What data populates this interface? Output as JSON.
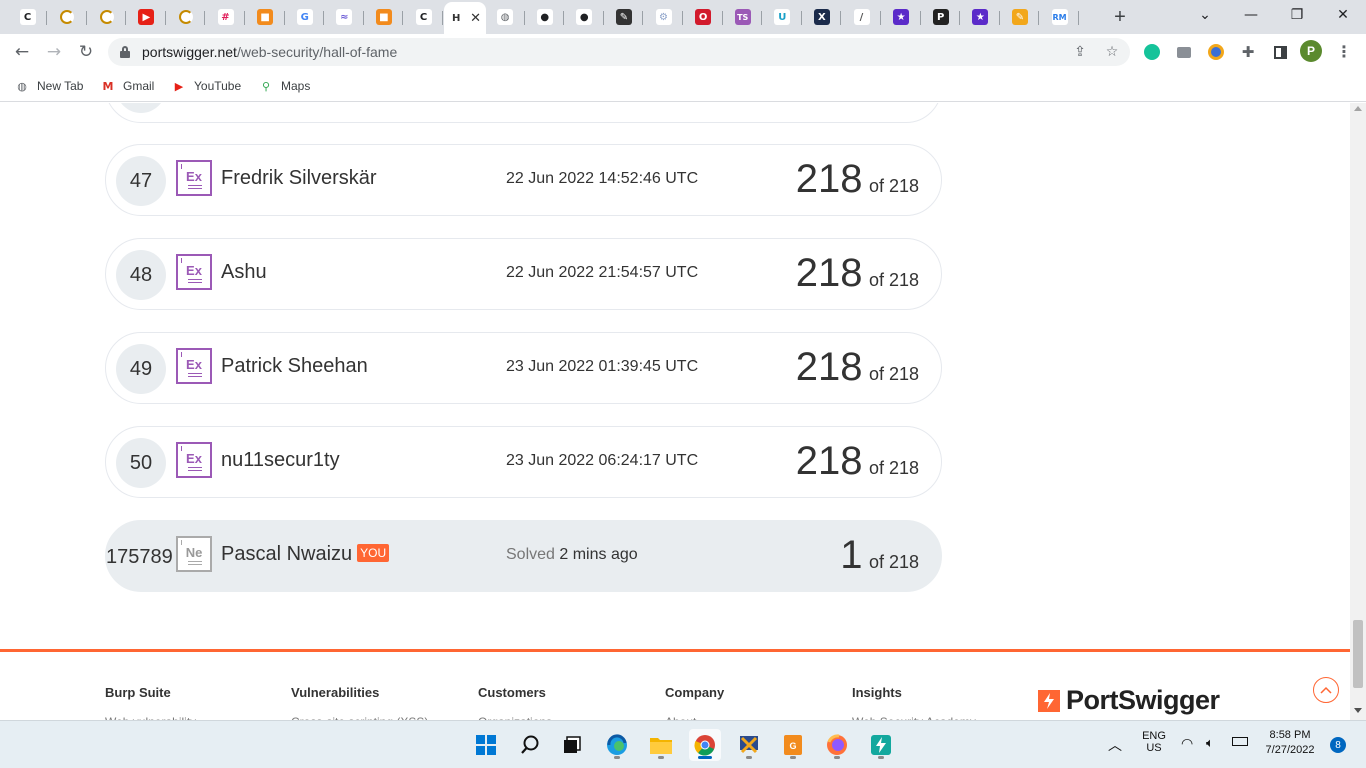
{
  "browser": {
    "tabs": [
      {
        "icon": "chatgpt-icon",
        "glyph": "C",
        "color": "#202124",
        "bg": "#ffffff"
      },
      {
        "icon": "loading-icon",
        "glyph": "",
        "color": "#c58a00",
        "bg": "#ffffff"
      },
      {
        "icon": "loading-icon",
        "glyph": "",
        "color": "#c58a00",
        "bg": "#ffffff"
      },
      {
        "icon": "youtube-icon",
        "glyph": "▶",
        "color": "#ffffff",
        "bg": "#e62117"
      },
      {
        "icon": "loading-icon",
        "glyph": "",
        "color": "#c58a00",
        "bg": "#ffffff"
      },
      {
        "icon": "slack-icon",
        "glyph": "#",
        "color": "#e01e5a",
        "bg": "#ffffff"
      },
      {
        "icon": "orange-cube-icon",
        "glyph": "■",
        "color": "#ffffff",
        "bg": "#f28b1d"
      },
      {
        "icon": "google-icon",
        "glyph": "G",
        "color": "#4285f4",
        "bg": "#ffffff"
      },
      {
        "icon": "wave-icon",
        "glyph": "≈",
        "color": "#6b5bd6",
        "bg": "#ffffff"
      },
      {
        "icon": "orange-cube-icon",
        "glyph": "■",
        "color": "#ffffff",
        "bg": "#f28b1d"
      },
      {
        "icon": "chatgpt-icon",
        "glyph": "C",
        "color": "#202124",
        "bg": "#ffffff"
      },
      {
        "icon": "active-page-icon",
        "glyph": "H",
        "color": "#333333",
        "bg": "#ffffff",
        "active": true
      },
      {
        "icon": "globe-icon",
        "glyph": "◍",
        "color": "#5f6368",
        "bg": "#ffffff"
      },
      {
        "icon": "github-icon",
        "glyph": "●",
        "color": "#202124",
        "bg": "#ffffff"
      },
      {
        "icon": "github-icon",
        "glyph": "●",
        "color": "#202124",
        "bg": "#ffffff"
      },
      {
        "icon": "notepad-icon",
        "glyph": "✎",
        "color": "#ffffff",
        "bg": "#333333"
      },
      {
        "icon": "gear-icon",
        "glyph": "⚙",
        "color": "#8aa0c8",
        "bg": "#ffffff"
      },
      {
        "icon": "opera-icon",
        "glyph": "O",
        "color": "#ffffff",
        "bg": "#d21a2c"
      },
      {
        "icon": "typescript-icon",
        "glyph": "TS",
        "color": "#ffffff",
        "bg": "#9b59b6"
      },
      {
        "icon": "u-logo-icon",
        "glyph": "U",
        "color": "#19a0c8",
        "bg": "#ffffff"
      },
      {
        "icon": "x-box-icon",
        "glyph": "X",
        "color": "#ffffff",
        "bg": "#1b2b4b"
      },
      {
        "icon": "slash-icon",
        "glyph": "/",
        "color": "#555555",
        "bg": "#ffffff"
      },
      {
        "icon": "star-icon",
        "glyph": "★",
        "color": "#ffffff",
        "bg": "#5b2bc9"
      },
      {
        "icon": "p-logo-icon",
        "glyph": "P",
        "color": "#ffffff",
        "bg": "#222222"
      },
      {
        "icon": "star-icon",
        "glyph": "★",
        "color": "#ffffff",
        "bg": "#5b2bc9"
      },
      {
        "icon": "pencil-icon",
        "glyph": "✎",
        "color": "#ffffff",
        "bg": "#f2a71b"
      },
      {
        "icon": "rm-logo-icon",
        "glyph": "RM",
        "color": "#2b7de9",
        "bg": "#ffffff"
      }
    ],
    "active_tab_label": "H",
    "url_domain": "portswigger.net",
    "url_path": "/web-security/hall-of-fame",
    "profile_initial": "P",
    "bookmarks": [
      {
        "label": "New Tab",
        "icon": "globe-icon",
        "glyph": "◍",
        "color": "#5f6368"
      },
      {
        "label": "Gmail",
        "icon": "gmail-icon",
        "glyph": "M",
        "color": "#d93025"
      },
      {
        "label": "YouTube",
        "icon": "youtube-icon",
        "glyph": "▶",
        "color": "#e62117"
      },
      {
        "label": "Maps",
        "icon": "maps-pin-icon",
        "glyph": "⚲",
        "color": "#34a853"
      }
    ]
  },
  "leaderboard": {
    "rows": [
      {
        "rank": "47",
        "level": "Ex",
        "name": "Fredrik Silverskär",
        "time": "22 Jun 2022 14:52:46 UTC",
        "score": "218",
        "of": "of 218"
      },
      {
        "rank": "48",
        "level": "Ex",
        "name": "Ashu",
        "time": "22 Jun 2022 21:54:57 UTC",
        "score": "218",
        "of": "of 218"
      },
      {
        "rank": "49",
        "level": "Ex",
        "name": "Patrick Sheehan",
        "time": "23 Jun 2022 01:39:45 UTC",
        "score": "218",
        "of": "of 218"
      },
      {
        "rank": "50",
        "level": "Ex",
        "name": "nu11secur1ty",
        "time": "23 Jun 2022 06:24:17 UTC",
        "score": "218",
        "of": "of 218"
      }
    ],
    "current_user": {
      "rank": "175789",
      "level": "Ne",
      "name": "Pascal Nwaizu",
      "you_badge": "YOU",
      "solved_label": "Solved",
      "solved_time": "2 mins ago",
      "score": "1",
      "of": "of 218"
    }
  },
  "footer": {
    "columns": [
      {
        "title": "Burp Suite",
        "sub": "Web vulnerability"
      },
      {
        "title": "Vulnerabilities",
        "sub": "Cross-site scripting (XSS)"
      },
      {
        "title": "Customers",
        "sub": "Organizations"
      },
      {
        "title": "Company",
        "sub": "About"
      },
      {
        "title": "Insights",
        "sub": "Web Security Academy"
      }
    ],
    "brand": "PortSwigger",
    "accent": "#ff6633"
  },
  "taskbar": {
    "apps": [
      "start-icon",
      "search-icon",
      "task-view-icon",
      "edge-icon",
      "file-explorer-icon",
      "chrome-icon",
      "app-icon",
      "pdf-icon",
      "firefox-icon",
      "bolt-app-icon"
    ],
    "lang_top": "ENG",
    "lang_bottom": "US",
    "time": "8:58 PM",
    "date": "7/27/2022",
    "notifications": "8"
  }
}
